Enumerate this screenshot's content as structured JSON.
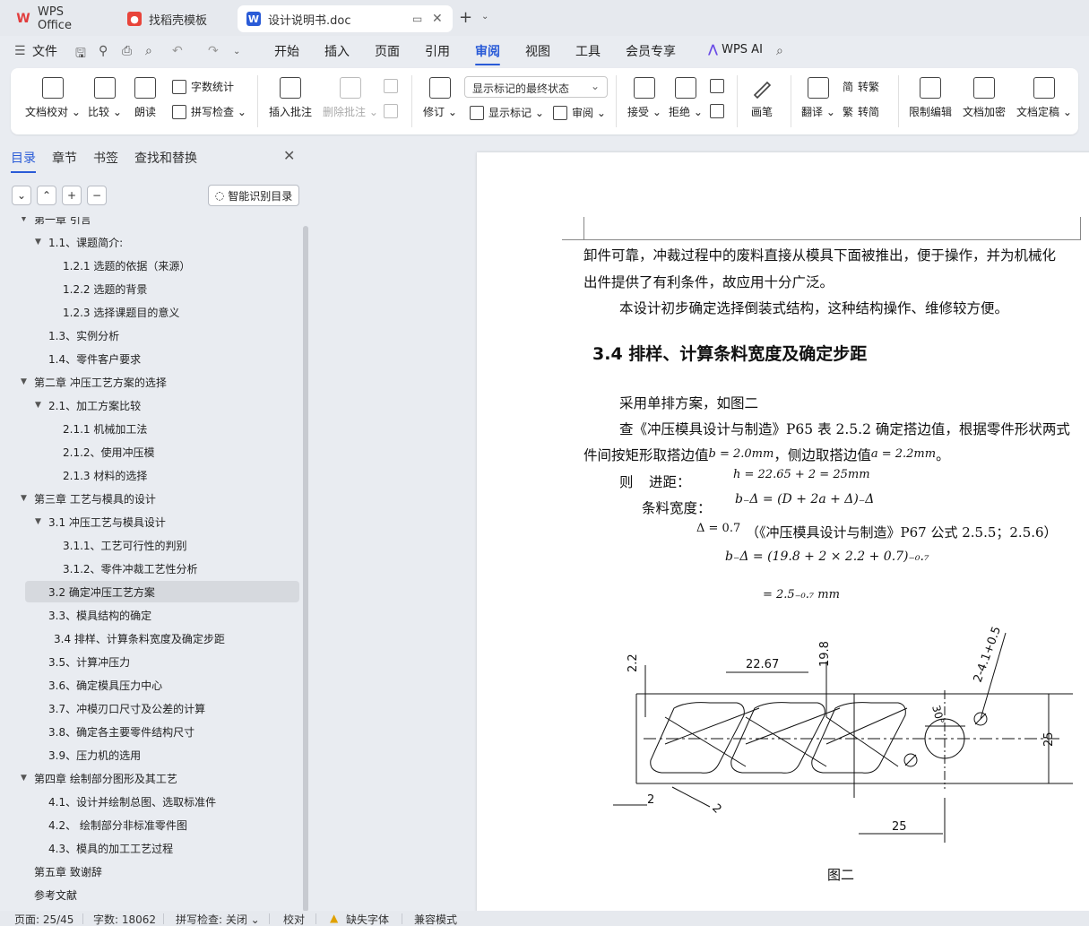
{
  "tabs": [
    {
      "label": "WPS Office",
      "color": "#e13d3d"
    },
    {
      "label": "找稻壳模板",
      "color": "#e8443a"
    },
    {
      "label": "设计说明书.doc",
      "color": "#2a5bd7"
    }
  ],
  "menu": {
    "file": "文件",
    "items": [
      "开始",
      "插入",
      "页面",
      "引用",
      "审阅",
      "视图",
      "工具",
      "会员专享"
    ],
    "active": "审阅",
    "ai": "WPS AI"
  },
  "ribbon": {
    "doc_check": "文档校对",
    "compare": "比较",
    "read_aloud": "朗读",
    "word_count": "字数统计",
    "spell_check": "拼写检查",
    "insert_comment": "插入批注",
    "delete_comment": "删除批注",
    "revise": "修订",
    "display_state": "显示标记的最终状态",
    "show_markup": "显示标记",
    "review": "审阅",
    "accept": "接受",
    "reject": "拒绝",
    "pen": "画笔",
    "translate": "翻译",
    "to_traditional": "转繁",
    "to_simplified": "转简",
    "restrict_edit": "限制编辑",
    "encrypt": "文档加密",
    "finalize": "文档定稿",
    "trad_char": "简",
    "simp_char": "繁"
  },
  "sidebar": {
    "tabs": [
      "目录",
      "章节",
      "书签",
      "查找和替换"
    ],
    "smart_toc": "智能识别目录",
    "toc": [
      {
        "label": "第一章   引言",
        "level": 0,
        "caret": true
      },
      {
        "label": "1.1、课题简介:",
        "level": 1,
        "caret": true
      },
      {
        "label": "1.2.1 选题的依据（来源）",
        "level": 2
      },
      {
        "label": "1.2.2 选题的背景",
        "level": 2
      },
      {
        "label": "1.2.3 选择课题目的意义",
        "level": 2
      },
      {
        "label": "1.3、实例分析",
        "level": 1
      },
      {
        "label": "1.4、零件客户要求",
        "level": 1
      },
      {
        "label": "第二章   冲压工艺方案的选择",
        "level": 0,
        "caret": true
      },
      {
        "label": "2.1、加工方案比较",
        "level": 1,
        "caret": true
      },
      {
        "label": "2.1.1 机械加工法",
        "level": 2
      },
      {
        "label": "2.1.2、使用冲压模",
        "level": 2
      },
      {
        "label": "2.1.3 材料的选择",
        "level": 2
      },
      {
        "label": "第三章  工艺与模具的设计",
        "level": 0,
        "caret": true
      },
      {
        "label": "3.1 冲压工艺与模具设计",
        "level": 1,
        "caret": true
      },
      {
        "label": "3.1.1、工艺可行性的判别",
        "level": 2
      },
      {
        "label": "3.1.2、零件冲裁工艺性分析",
        "level": 2
      },
      {
        "label": "3.2 确定冲压工艺方案",
        "level": 1,
        "selected": true
      },
      {
        "label": "3.3、模具结构的确定",
        "level": 1
      },
      {
        "label": "3.4 排样、计算条料宽度及确定步距",
        "level": 1.5
      },
      {
        "label": "3.5、计算冲压力",
        "level": 1
      },
      {
        "label": "3.6、确定模具压力中心",
        "level": 1
      },
      {
        "label": "3.7、冲模刃口尺寸及公差的计算",
        "level": 1
      },
      {
        "label": "3.8、确定各主要零件结构尺寸",
        "level": 1
      },
      {
        "label": "3.9、压力机的选用",
        "level": 1
      },
      {
        "label": "第四章  绘制部分图形及其工艺",
        "level": 0,
        "caret": true
      },
      {
        "label": "4.1、设计并绘制总图、选取标准件",
        "level": 1
      },
      {
        "label": "4.2、   绘制部分非标准零件图",
        "level": 1
      },
      {
        "label": "4.3、模具的加工工艺过程",
        "level": 1
      },
      {
        "label": "第五章  致谢辞",
        "level": 0
      },
      {
        "label": "参考文献",
        "level": 0
      }
    ]
  },
  "document": {
    "para1_line1": "卸件可靠，冲裁过程中的废料直接从模具下面被推出，便于操作，并为机械化",
    "para1_line2": "出件提供了有利条件，故应用十分广泛。",
    "para2": "本设计初步确定选择倒装式结构，这种结构操作、维修较方便。",
    "heading": "3.4 排样、计算条料宽度及确定步距",
    "para3": "采用单排方案，如图二",
    "para4_line1": "查《冲压模具设计与制造》P65 表 2.5.2 确定搭边值，根据零件形状两式",
    "para4_line2a": "件间按矩形取搭边值",
    "para4_math1": "b = 2.0mm",
    "para4_mid": "，侧边取搭边值",
    "para4_math2": "a = 2.2mm",
    "para4_end": "。",
    "then": "则",
    "step_label": "进距：",
    "step_formula": "h = 22.65 + 2 = 25mm",
    "width_label": "条料宽度：",
    "width_formula": "b₋Δ = (D + 2a + Δ)₋Δ",
    "delta": "Δ = 0.7",
    "delta_ref": "（《冲压模具设计与制造》P67 公式 2.5.5；2.5.6）",
    "calc1": "b₋Δ = (19.8 + 2 × 2.2 + 0.7)₋₀.₇",
    "calc2": "= 2.5₋₀.₇ mm",
    "figure_caption": "图二",
    "dims": {
      "d1": "2.2",
      "d2": "22.67",
      "d3": "19.8",
      "d4": "2-4.1+0.5",
      "d4b": "0",
      "d5": "30°",
      "d6": "25",
      "d7": "2",
      "d8": "2",
      "d9": "25"
    }
  },
  "status": {
    "page": "页面: 25/45",
    "words": "字数: 18062",
    "spell": "拼写检查: 关闭",
    "proof": "校对",
    "missing_font": "缺失字体",
    "compat": "兼容模式"
  }
}
